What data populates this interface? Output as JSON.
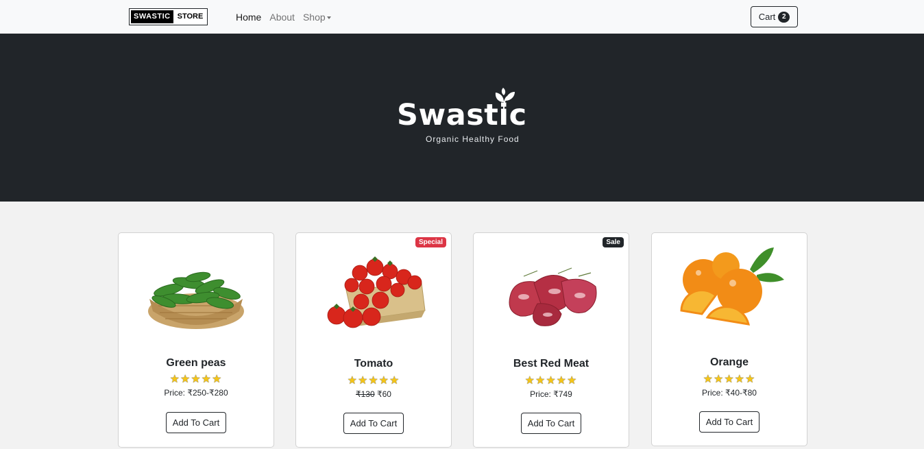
{
  "navbar": {
    "brand_left": "SWASTIC",
    "brand_right": "STORE",
    "links": [
      "Home",
      "About",
      "Shop"
    ],
    "cart_label": "Cart",
    "cart_count": "2"
  },
  "hero": {
    "logo": "Swastic",
    "tagline": "Organic Healthy Food"
  },
  "products": [
    {
      "name": "Green peas",
      "stars": "★★★★★",
      "rating": 5,
      "price": "Price: ₹250-₹280",
      "button": "Add To Cart",
      "image": "green-peas-basket"
    },
    {
      "name": "Tomato",
      "stars": "★★★★★",
      "rating": 5,
      "old_price": "₹130",
      "new_price": "₹60",
      "button": "Add To Cart",
      "badge": "Special",
      "image": "tomatoes-crate"
    },
    {
      "name": "Best Red Meat",
      "stars": "★★★★★",
      "rating": 5,
      "price": "Price: ₹749",
      "button": "Add To Cart",
      "badge": "Sale",
      "image": "red-meat"
    },
    {
      "name": "Orange",
      "stars": "★★★★★",
      "rating": 5,
      "price": "Price: ₹40-₹80",
      "button": "Add To Cart",
      "image": "oranges"
    }
  ],
  "colors": {
    "navbar_bg": "#f8f9fa",
    "hero_bg": "#212529",
    "page_bg": "#f2f2f2",
    "special_badge": "#dc3545",
    "sale_badge": "#212529",
    "star": "#f5c518"
  }
}
